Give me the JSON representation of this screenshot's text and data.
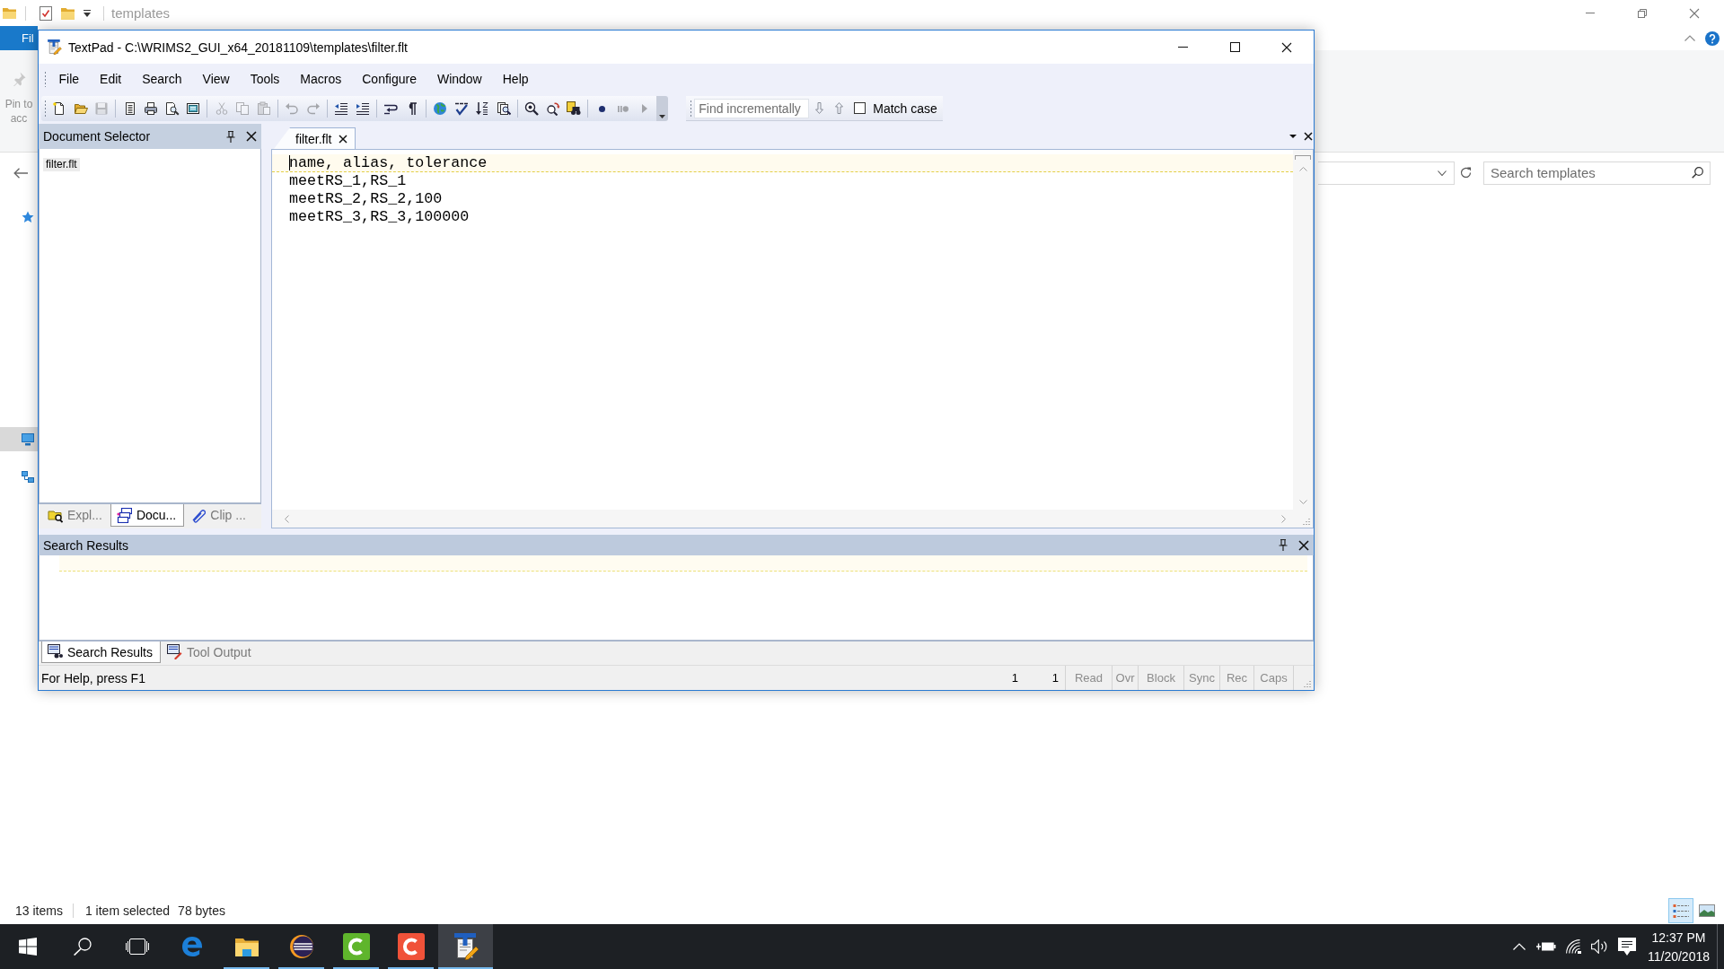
{
  "explorer": {
    "location": "templates",
    "file_tab": "Fil",
    "pin_label": [
      "Pin to",
      "acc"
    ],
    "nav_pane": [
      {
        "kind": "favorites",
        "selected": false
      },
      {
        "kind": "computer",
        "selected": true
      },
      {
        "kind": "network",
        "selected": false
      }
    ],
    "search": {
      "placeholder": "Search templates"
    },
    "status_bar": {
      "item_count": "13 items",
      "selection": "1 item selected",
      "size": "78 bytes"
    },
    "views": [
      {
        "kind": "details",
        "selected": true
      },
      {
        "kind": "large-icons",
        "selected": false
      }
    ]
  },
  "textpad": {
    "window": {
      "title": "TextPad - C:\\WRIMS2_GUI_x64_20181109\\templates\\filter.flt"
    },
    "menu": [
      "File",
      "Edit",
      "Search",
      "View",
      "Tools",
      "Macros",
      "Configure",
      "Window",
      "Help"
    ],
    "toolbar": [
      {
        "kind": "new",
        "disabled": false
      },
      {
        "kind": "open",
        "disabled": false
      },
      {
        "kind": "save",
        "disabled": true
      },
      {
        "kind": "separator"
      },
      {
        "kind": "document-list",
        "disabled": false
      },
      {
        "kind": "print",
        "disabled": false
      },
      {
        "kind": "print-preview",
        "disabled": false
      },
      {
        "kind": "manage",
        "disabled": false
      },
      {
        "kind": "separator"
      },
      {
        "kind": "cut",
        "disabled": true
      },
      {
        "kind": "copy",
        "disabled": true
      },
      {
        "kind": "paste",
        "disabled": true
      },
      {
        "kind": "separator"
      },
      {
        "kind": "undo",
        "disabled": true
      },
      {
        "kind": "redo",
        "disabled": true
      },
      {
        "kind": "separator"
      },
      {
        "kind": "outdent",
        "disabled": false
      },
      {
        "kind": "indent",
        "disabled": false
      },
      {
        "kind": "separator"
      },
      {
        "kind": "word-wrap",
        "disabled": false
      },
      {
        "kind": "pilcrow",
        "disabled": false
      },
      {
        "kind": "separator"
      },
      {
        "kind": "globe",
        "disabled": false
      },
      {
        "kind": "spell-check",
        "disabled": false
      },
      {
        "kind": "sort",
        "disabled": false
      },
      {
        "kind": "find-in-files",
        "disabled": false
      },
      {
        "kind": "separator"
      },
      {
        "kind": "find",
        "disabled": false
      },
      {
        "kind": "replace",
        "disabled": false
      },
      {
        "kind": "find-next",
        "disabled": false
      },
      {
        "kind": "separator"
      },
      {
        "kind": "record",
        "disabled": false
      },
      {
        "kind": "pause",
        "disabled": true
      },
      {
        "kind": "play",
        "disabled": true
      }
    ],
    "find_bar": {
      "placeholder": "Find incrementally",
      "match_case": {
        "label": "Match case",
        "checked": false
      }
    },
    "document_selector": {
      "title": "Document Selector",
      "documents": [
        {
          "name": "filter.flt",
          "selected": true
        }
      ],
      "tabs": [
        {
          "kind": "explorer",
          "label": "Expl...",
          "selected": false
        },
        {
          "kind": "documents",
          "label": "Docu...",
          "selected": true
        },
        {
          "kind": "clips",
          "label": "Clip ...",
          "selected": false
        }
      ]
    },
    "editor": {
      "tabs": [
        {
          "label": "filter.flt",
          "selected": true
        }
      ],
      "lines": [
        {
          "text": "name, alias, tolerance",
          "current": true
        },
        {
          "text": "meetRS_1,RS_1",
          "current": false
        },
        {
          "text": "meetRS_2,RS_2,100",
          "current": false
        },
        {
          "text": "meetRS_3,RS_3,100000",
          "current": false
        }
      ]
    },
    "search_results": {
      "title": "Search Results",
      "tabs": [
        {
          "kind": "search",
          "label": "Search Results",
          "selected": true
        },
        {
          "kind": "tool",
          "label": "Tool Output",
          "selected": false
        }
      ]
    },
    "status_bar": {
      "message": "For Help, press F1",
      "line": "1",
      "column": "1",
      "indicators": [
        {
          "label": "Read",
          "on": false
        },
        {
          "label": "Ovr",
          "on": false
        },
        {
          "label": "Block",
          "on": false
        },
        {
          "label": "Sync",
          "on": false
        },
        {
          "label": "Rec",
          "on": false
        },
        {
          "label": "Caps",
          "on": false
        }
      ]
    }
  },
  "taskbar": {
    "apps": [
      {
        "kind": "browser",
        "running": false,
        "active": false
      },
      {
        "kind": "files",
        "running": true,
        "active": false
      },
      {
        "kind": "ide",
        "running": true,
        "active": false
      },
      {
        "kind": "recorder",
        "running": true,
        "active": false
      },
      {
        "kind": "video-editor",
        "running": true,
        "active": false
      },
      {
        "kind": "text-editor",
        "running": true,
        "active": true
      }
    ],
    "clock": {
      "time": "12:37 PM",
      "date": "11/20/2018"
    }
  }
}
